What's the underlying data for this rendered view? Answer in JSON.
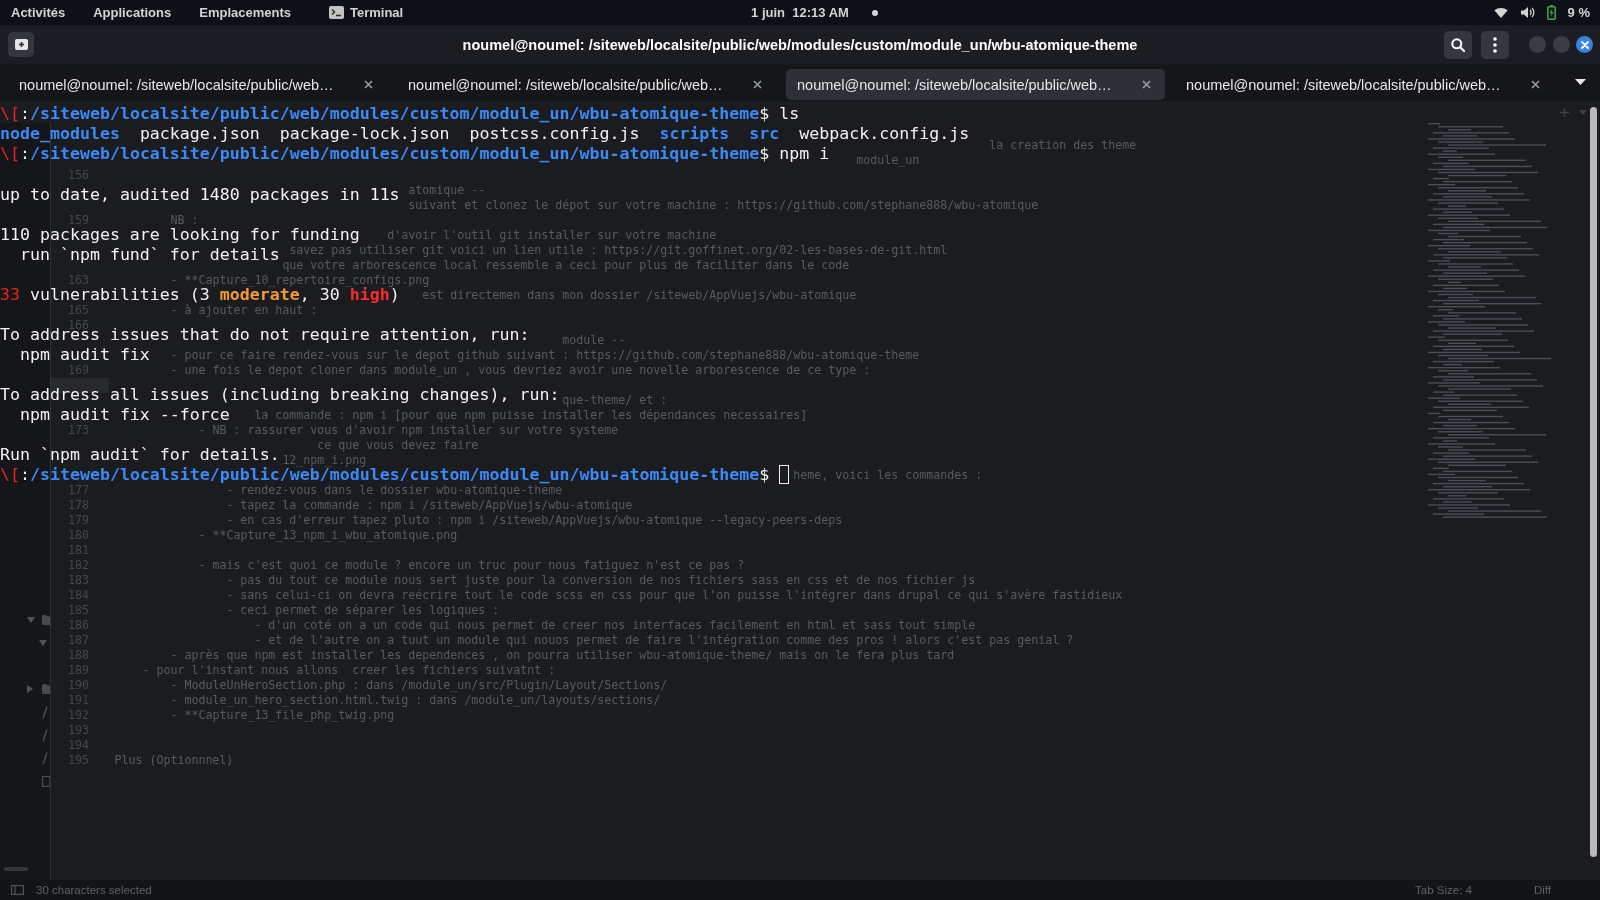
{
  "top_bar": {
    "menus": [
      "Activités",
      "Applications",
      "Emplacements"
    ],
    "app_menu": "Terminal",
    "clock": "1 juin  12:13 AM",
    "battery": "9 %"
  },
  "window": {
    "title": "noumel@noumel: /siteweb/localsite/public/web/modules/custom/module_un/wbu-atomique-theme"
  },
  "tabs": [
    {
      "label": "noumel@noumel: /siteweb/localsite/public/web…",
      "selected": false
    },
    {
      "label": "noumel@noumel: /siteweb/localsite/public/web…",
      "selected": false
    },
    {
      "label": "noumel@noumel: /siteweb/localsite/public/web…",
      "selected": true
    },
    {
      "label": "noumel@noumel: /siteweb/localsite/public/web…",
      "selected": false
    }
  ],
  "terminal": {
    "blocks": [
      [
        {
          "segments": [
            {
              "kind": "escape",
              "text": "\\["
            },
            {
              "kind": "plain",
              "text": ":"
            },
            {
              "kind": "path",
              "text": "/siteweb/localsite/public/web/modules/custom/module_un/wbu-atomique-theme"
            },
            {
              "kind": "plain",
              "text": "$ ls"
            }
          ],
          "cursor": false
        },
        {
          "entries": [
            {
              "kind": "dir",
              "text": "node_modules"
            },
            {
              "kind": "file",
              "text": "package.json"
            },
            {
              "kind": "file",
              "text": "package-lock.json"
            },
            {
              "kind": "file",
              "text": "postcss.config.js"
            },
            {
              "kind": "dir",
              "text": "scripts"
            },
            {
              "kind": "dir",
              "text": "src"
            },
            {
              "kind": "file",
              "text": "webpack.config.js"
            }
          ],
          "cursor": false
        },
        {
          "segments": [
            {
              "kind": "escape",
              "text": "\\["
            },
            {
              "kind": "plain",
              "text": ":"
            },
            {
              "kind": "path",
              "text": "/siteweb/localsite/public/web/modules/custom/module_un/wbu-atomique-theme"
            },
            {
              "kind": "plain",
              "text": "$ npm i"
            }
          ],
          "cursor": false
        }
      ],
      [
        {
          "segments": [
            {
              "kind": "plain",
              "text": "up to date, audited 1480 packages in 11s"
            }
          ],
          "cursor": false
        }
      ],
      [
        {
          "segments": [
            {
              "kind": "plain",
              "text": "110 packages are looking for funding"
            }
          ],
          "cursor": false
        },
        {
          "segments": [
            {
              "kind": "plain",
              "text": "  run `npm fund` for details"
            }
          ],
          "cursor": false
        }
      ],
      [
        {
          "segments": [
            {
              "kind": "count",
              "text": "33"
            },
            {
              "kind": "plain",
              "text": " vulnerabilities (3 "
            },
            {
              "kind": "moderate",
              "text": "moderate"
            },
            {
              "kind": "plain",
              "text": ", 30 "
            },
            {
              "kind": "high",
              "text": "high"
            },
            {
              "kind": "plain",
              "text": ")"
            }
          ],
          "cursor": false
        }
      ],
      [
        {
          "segments": [
            {
              "kind": "plain",
              "text": "To address issues that do not require attention, run:"
            }
          ],
          "cursor": false
        },
        {
          "segments": [
            {
              "kind": "plain",
              "text": "  npm audit fix"
            }
          ],
          "cursor": false
        }
      ],
      [
        {
          "segments": [
            {
              "kind": "plain",
              "text": "To address all issues (including breaking changes), run:"
            }
          ],
          "cursor": false
        },
        {
          "segments": [
            {
              "kind": "plain",
              "text": "  npm audit fix --force"
            }
          ],
          "cursor": false
        }
      ],
      [
        {
          "segments": [
            {
              "kind": "plain",
              "text": "Run `npm audit` for details."
            }
          ],
          "cursor": false
        },
        {
          "segments": [
            {
              "kind": "escape",
              "text": "\\["
            },
            {
              "kind": "plain",
              "text": ":"
            },
            {
              "kind": "path",
              "text": "/siteweb/localsite/public/web/modules/custom/module_un/wbu-atomique-theme"
            },
            {
              "kind": "plain",
              "text": "$"
            }
          ],
          "cursor": true
        }
      ]
    ]
  },
  "editor": {
    "lines": [
      {
        "text": "                                                                                                                             la creation des theme",
        "current": false
      },
      {
        "text": "                                                                                                          module_un",
        "current": false
      },
      {
        "number": "156",
        "current": false
      },
      {
        "text": "                                          atomique --",
        "current": false
      },
      {
        "text": "                                          suivant et clonez le dépot sur votre machine : https://github.com/stephane888/wbu-atomique",
        "current": false
      },
      {
        "number": "159",
        "text": "        NB :",
        "current": false
      },
      {
        "text": "                                       d'avoir l'outil git installer sur votre machine",
        "current": false
      },
      {
        "text": "                         savez pas utiliser git voici un lien utile : https://git.goffinet.org/02-les-bases-de-git.html",
        "current": false
      },
      {
        "text": "                        que votre arborescence local ressemble a ceci pour plus de faciliter dans le code",
        "current": false
      },
      {
        "number": "163",
        "text": "        - **Capture_10_repertoire_configs.png",
        "current": false
      },
      {
        "text": "                                            est directemen dans mon dossier /siteweb/AppVuejs/wbu-atomique",
        "current": false
      },
      {
        "number": "165",
        "text": "        - à ajouter en haut :",
        "current": false
      },
      {
        "number": "166",
        "current": false
      },
      {
        "text": "                                                                module --",
        "current": false
      },
      {
        "text": "        - pour ce faire rendez-vous sur le depot github suivant : https://github.com/stephane888/wbu-atomique-theme",
        "current": false
      },
      {
        "number": "169",
        "text": "        - une fois le depot cloner dans module_un , vous devriez avoir une novelle arborescence de ce type :",
        "current": false
      },
      {
        "current": true
      },
      {
        "text": "                                                                que-theme/ et :",
        "current": false
      },
      {
        "text": "                    la commande : npm i [pour que npm puisse installer les dépendances necessaires]",
        "current": false
      },
      {
        "number": "173",
        "text": "            - NB : rassurer vous d'avoir npm installer sur votre systeme",
        "current": false
      },
      {
        "text": "                             ce que vous devez faire",
        "current": false
      },
      {
        "text": "                        12_npm_i.png",
        "current": false
      },
      {
        "text": "                                                                                                 heme, voici les commandes :",
        "current": false
      },
      {
        "number": "177",
        "text": "                - rendez-vous dans le dossier wbu-atomique-theme",
        "current": false
      },
      {
        "number": "178",
        "text": "                - tapez la commande : npm i /siteweb/AppVuejs/wbu-atomique",
        "current": false
      },
      {
        "number": "179",
        "text": "                - en cas d'erreur tapez pluto : npm i /siteweb/AppVuejs/wbu-atomique --legacy-peers-deps",
        "current": false
      },
      {
        "number": "180",
        "text": "            - **Capture_13_npm_i_wbu_atomique.png",
        "current": false
      },
      {
        "number": "181",
        "current": false
      },
      {
        "number": "182",
        "text": "            - mais c'est quoi ce module ? encore un truc pour nous fatiguez n'est ce pas ?",
        "current": false
      },
      {
        "number": "183",
        "text": "                - pas du tout ce module nous sert juste pour la conversion de nos fichiers sass en css et de nos fichier js",
        "current": false
      },
      {
        "number": "184",
        "text": "                - sans celui-ci on devra reécrire tout le code scss en css pour que l'on puisse l'intégrer dans drupal ce qui s'avère fastidieux",
        "current": false
      },
      {
        "number": "185",
        "text": "                - ceci permet de séparer les logiques :",
        "current": false
      },
      {
        "number": "186",
        "text": "                    - d'un coté on a un code qui nous permet de creer nos interfaces facilement en html et sass tout simple",
        "current": false
      },
      {
        "number": "187",
        "text": "                    - et de l'autre on a tuut un module qui nouos permet de faire l'intégration comme des pros ! alors c'est pas genial ?",
        "current": false
      },
      {
        "number": "188",
        "text": "        - après que npm est installer les dependences , on pourra utiliser wbu-atomique-theme/ mais on le fera plus tard",
        "current": false
      },
      {
        "number": "189",
        "text": "    - pour l'instant nous allons  creer les fichiers suivatnt :",
        "current": false
      },
      {
        "number": "190",
        "text": "        - ModuleUnHeroSection.php : dans /module_un/src/Plugin/Layout/Sections/",
        "current": false
      },
      {
        "number": "191",
        "text": "        - module_un_hero_section.html.twig : dans /module_un/layouts/sections/",
        "current": false
      },
      {
        "number": "192",
        "text": "        - **Capture_13_file_php_twig.png",
        "current": false
      },
      {
        "number": "193",
        "current": false
      },
      {
        "number": "194",
        "current": false
      },
      {
        "number": "195",
        "text": "Plus (Optionnnel)",
        "current": false
      }
    ],
    "tree": [
      {
        "kind": "folder",
        "expanded": true,
        "children": [
          {
            "kind": "folder",
            "expanded": true
          }
        ]
      },
      {
        "kind": "folder",
        "expanded": false
      },
      {
        "kind": "link"
      },
      {
        "kind": "link"
      },
      {
        "kind": "link"
      },
      {
        "kind": "file"
      }
    ],
    "status": {
      "selection": "30 characters selected",
      "tab_size": "Tab Size: 4",
      "grammar": "Diff"
    }
  }
}
